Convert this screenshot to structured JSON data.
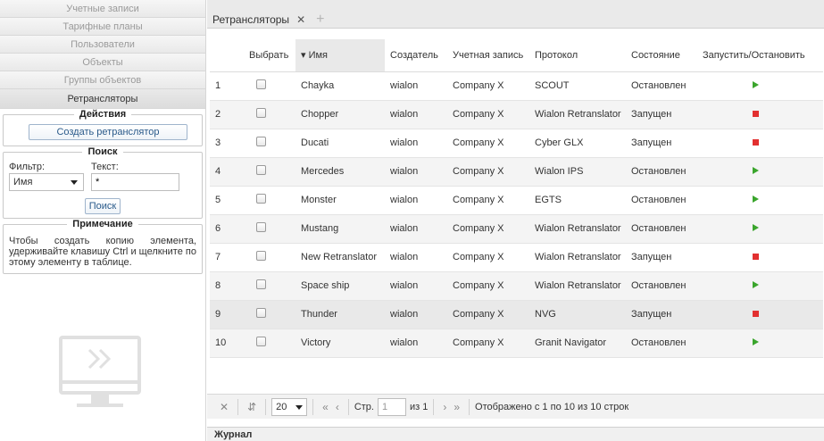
{
  "sidebar": {
    "nav": [
      {
        "label": "Учетные записи"
      },
      {
        "label": "Тарифные планы"
      },
      {
        "label": "Пользователи"
      },
      {
        "label": "Объекты"
      },
      {
        "label": "Группы объектов"
      },
      {
        "label": "Ретрансляторы"
      }
    ],
    "actions": {
      "title": "Действия",
      "create_label": "Создать ретранслятор"
    },
    "search": {
      "title": "Поиск",
      "filter_label": "Фильтр:",
      "text_label": "Текст:",
      "filter_value": "Имя",
      "text_value": "*",
      "search_button": "Поиск"
    },
    "note": {
      "title": "Примечание",
      "text": "Чтобы создать копию элемента, удерживайте клавишу Ctrl и щелкните по этому элементу в таблице."
    }
  },
  "main": {
    "tab": {
      "label": "Ретрансляторы",
      "close": "✕",
      "add": "+"
    },
    "columns": [
      "",
      "Выбрать",
      "▾ Имя",
      "Создатель",
      "Учетная запись",
      "Протокол",
      "Состояние",
      "Запустить/Остановить"
    ],
    "rows": [
      {
        "n": "1",
        "name": "Chayka",
        "creator": "wialon",
        "account": "Company X",
        "protocol": "SCOUT",
        "state": "Остановлен",
        "action": "play"
      },
      {
        "n": "2",
        "name": "Chopper",
        "creator": "wialon",
        "account": "Company X",
        "protocol": "Wialon Retranslator",
        "state": "Запущен",
        "action": "stop"
      },
      {
        "n": "3",
        "name": "Ducati",
        "creator": "wialon",
        "account": "Company X",
        "protocol": "Cyber GLX",
        "state": "Запущен",
        "action": "stop"
      },
      {
        "n": "4",
        "name": "Mercedes",
        "creator": "wialon",
        "account": "Company X",
        "protocol": "Wialon IPS",
        "state": "Остановлен",
        "action": "play"
      },
      {
        "n": "5",
        "name": "Monster",
        "creator": "wialon",
        "account": "Company X",
        "protocol": "EGTS",
        "state": "Остановлен",
        "action": "play"
      },
      {
        "n": "6",
        "name": "Mustang",
        "creator": "wialon",
        "account": "Company X",
        "protocol": "Wialon Retranslator",
        "state": "Остановлен",
        "action": "play"
      },
      {
        "n": "7",
        "name": "New Retranslator",
        "creator": "wialon",
        "account": "Company X",
        "protocol": "Wialon Retranslator",
        "state": "Запущен",
        "action": "stop"
      },
      {
        "n": "8",
        "name": "Space ship",
        "creator": "wialon",
        "account": "Company X",
        "protocol": "Wialon Retranslator",
        "state": "Остановлен",
        "action": "play"
      },
      {
        "n": "9",
        "name": "Thunder",
        "creator": "wialon",
        "account": "Company X",
        "protocol": "NVG",
        "state": "Запущен",
        "action": "stop"
      },
      {
        "n": "10",
        "name": "Victory",
        "creator": "wialon",
        "account": "Company X",
        "protocol": "Granit Navigator",
        "state": "Остановлен",
        "action": "play"
      }
    ],
    "pager": {
      "page_size": "20",
      "page_label": "Стр.",
      "page_value": "1",
      "of_label": "из 1",
      "status": "Отображено с 1 по 10 из 10 строк"
    },
    "journal": "Журнал"
  },
  "colors": {
    "play": "#3aa52c",
    "stop": "#e23030",
    "link": "#2a5a8a"
  }
}
